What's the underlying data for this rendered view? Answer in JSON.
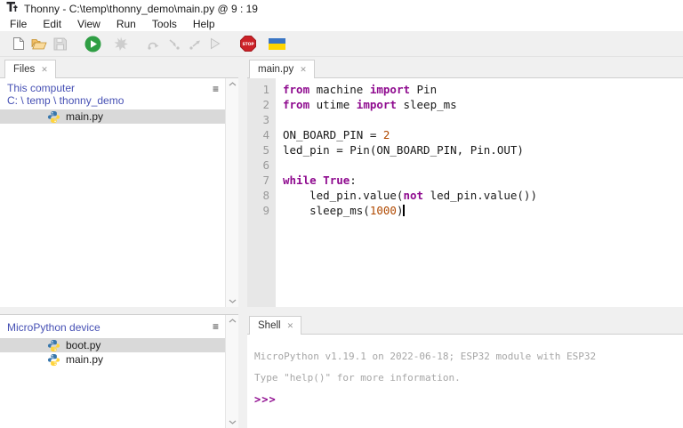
{
  "window": {
    "title": "Thonny  -  C:\\temp\\thonny_demo\\main.py  @  9 : 19"
  },
  "menu": {
    "items": [
      "File",
      "Edit",
      "View",
      "Run",
      "Tools",
      "Help"
    ]
  },
  "toolbar": {
    "items": [
      {
        "id": "new-file",
        "label": "New"
      },
      {
        "id": "open-file",
        "label": "Load"
      },
      {
        "id": "save-file",
        "label": "Save"
      },
      {
        "id": "run-script",
        "label": "Run current script"
      },
      {
        "id": "debug-script",
        "label": "Debug current script"
      },
      {
        "id": "step-over",
        "label": "Step over"
      },
      {
        "id": "step-into",
        "label": "Step into"
      },
      {
        "id": "step-out",
        "label": "Step out"
      },
      {
        "id": "resume",
        "label": "Resume"
      },
      {
        "id": "stop",
        "label": "Stop/Restart backend"
      },
      {
        "id": "ukraine-flag",
        "label": "Support Ukraine"
      }
    ]
  },
  "files_panel": {
    "tab_label": "Files",
    "computer_label": "This computer",
    "path_label": "C: \\ temp \\ thonny_demo",
    "items": [
      {
        "name": "main.py",
        "selected": true
      }
    ]
  },
  "device_panel": {
    "header": "MicroPython device",
    "items": [
      {
        "name": "boot.py",
        "selected": true
      },
      {
        "name": "main.py",
        "selected": false
      }
    ]
  },
  "editor": {
    "tab_label": "main.py",
    "lines": [
      {
        "num": 1,
        "tokens": [
          {
            "c": "k",
            "t": "from"
          },
          {
            "c": "p",
            "t": " machine "
          },
          {
            "c": "k",
            "t": "import"
          },
          {
            "c": "p",
            "t": " Pin"
          }
        ]
      },
      {
        "num": 2,
        "tokens": [
          {
            "c": "k",
            "t": "from"
          },
          {
            "c": "p",
            "t": " utime "
          },
          {
            "c": "k",
            "t": "import"
          },
          {
            "c": "p",
            "t": " sleep_ms"
          }
        ]
      },
      {
        "num": 3,
        "tokens": []
      },
      {
        "num": 4,
        "tokens": [
          {
            "c": "p",
            "t": "ON_BOARD_PIN = "
          },
          {
            "c": "n",
            "t": "2"
          }
        ]
      },
      {
        "num": 5,
        "tokens": [
          {
            "c": "p",
            "t": "led_pin = Pin(ON_BOARD_PIN, Pin.OUT)"
          }
        ]
      },
      {
        "num": 6,
        "tokens": []
      },
      {
        "num": 7,
        "tokens": [
          {
            "c": "k",
            "t": "while"
          },
          {
            "c": "p",
            "t": " "
          },
          {
            "c": "k",
            "t": "True"
          },
          {
            "c": "p",
            "t": ":"
          }
        ]
      },
      {
        "num": 8,
        "tokens": [
          {
            "c": "p",
            "t": "    led_pin.value("
          },
          {
            "c": "k",
            "t": "not"
          },
          {
            "c": "p",
            "t": " led_pin.value())"
          }
        ]
      },
      {
        "num": 9,
        "tokens": [
          {
            "c": "p",
            "t": "    sleep_ms("
          },
          {
            "c": "n",
            "t": "1000"
          },
          {
            "c": "p",
            "t": ")"
          }
        ],
        "caret": true
      }
    ]
  },
  "shell": {
    "tab_label": "Shell",
    "lines": [
      "MicroPython v1.19.1 on 2022-06-18; ESP32 module with ESP32",
      "Type \"help()\" for more information."
    ],
    "prompt": ">>>"
  },
  "colors": {
    "keyword": "#8f0b8f",
    "number": "#b04900",
    "panel_link": "#4650b4",
    "selection_bg": "#d9d9d9",
    "shell_text": "#a6a6a6",
    "gutter_bg": "#e7e7e7",
    "toolbar_bg": "#f0f0f0",
    "run_green": "#2f9e44",
    "stop_red": "#cc2127",
    "flag_blue": "#3a75c4",
    "flag_yellow": "#ffd500"
  }
}
